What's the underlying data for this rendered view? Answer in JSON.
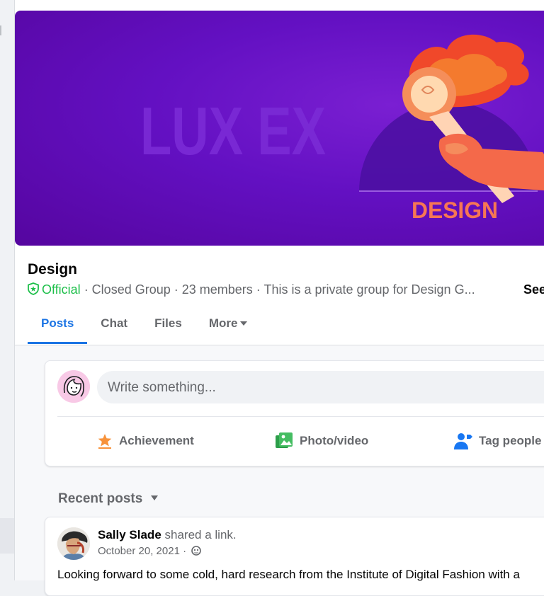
{
  "group": {
    "name": "Design",
    "official_label": "Official",
    "meta_text": " · Closed Group · 23 members · This is a private group for Design G...",
    "see_more": "See"
  },
  "cover": {
    "title_text": "LUX EX",
    "badge_text": "DESIGN",
    "bg_color": "#6310c2"
  },
  "tabs": [
    {
      "label": "Posts",
      "active": true
    },
    {
      "label": "Chat"
    },
    {
      "label": "Files"
    },
    {
      "label": "More"
    }
  ],
  "composer": {
    "placeholder": "Write something...",
    "actions": [
      {
        "label": "Achievement",
        "icon": "achievement-icon",
        "color": "#f7923a"
      },
      {
        "label": "Photo/video",
        "icon": "photo-video-icon",
        "color": "#45bd62"
      },
      {
        "label": "Tag people",
        "icon": "tag-people-icon",
        "color": "#1877f2"
      }
    ]
  },
  "recent_posts": {
    "label": "Recent posts"
  },
  "post": {
    "author": "Sally Slade",
    "action": "shared a link.",
    "date": "October 20, 2021 ·",
    "body": "Looking forward to some cold, hard research from the Institute of Digital Fashion with a"
  },
  "colors": {
    "accent": "#1b74e4",
    "official": "#1dbf4a",
    "secondary_text": "#65676b"
  }
}
